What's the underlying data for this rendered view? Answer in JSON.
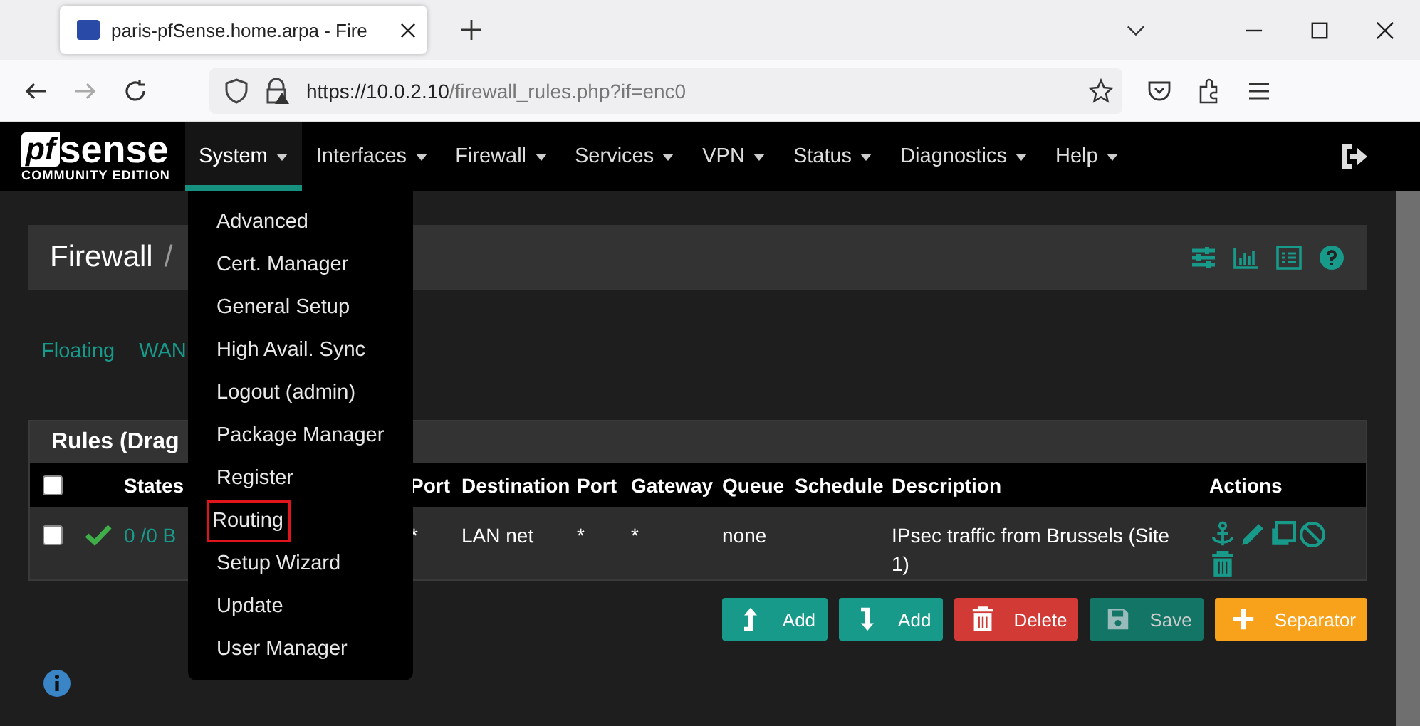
{
  "browser": {
    "tab_title": "paris-pfSense.home.arpa - Fire",
    "url_host": "https://10.0.2.10",
    "url_path": "/firewall_rules.php?if=enc0"
  },
  "logo": {
    "pf": "pf",
    "sense": "sense",
    "edition": "COMMUNITY EDITION"
  },
  "nav": [
    {
      "label": "System",
      "selected": true
    },
    {
      "label": "Interfaces",
      "selected": false
    },
    {
      "label": "Firewall",
      "selected": false
    },
    {
      "label": "Services",
      "selected": false
    },
    {
      "label": "VPN",
      "selected": false
    },
    {
      "label": "Status",
      "selected": false
    },
    {
      "label": "Diagnostics",
      "selected": false
    },
    {
      "label": "Help",
      "selected": false
    }
  ],
  "system_menu": [
    {
      "label": "Advanced",
      "highlighted": false
    },
    {
      "label": "Cert. Manager",
      "highlighted": false
    },
    {
      "label": "General Setup",
      "highlighted": false
    },
    {
      "label": "High Avail. Sync",
      "highlighted": false
    },
    {
      "label": "Logout (admin)",
      "highlighted": false
    },
    {
      "label": "Package Manager",
      "highlighted": false
    },
    {
      "label": "Register",
      "highlighted": false
    },
    {
      "label": "Routing",
      "highlighted": true
    },
    {
      "label": "Setup Wizard",
      "highlighted": false
    },
    {
      "label": "Update",
      "highlighted": false
    },
    {
      "label": "User Manager",
      "highlighted": false
    }
  ],
  "page_title": {
    "section": "Firewall",
    "separator": "/"
  },
  "tabs": [
    {
      "label": "Floating",
      "selected": false
    },
    {
      "label": "WAN",
      "selected": false
    }
  ],
  "rules_panel": {
    "title": "Rules (Drag",
    "header": {
      "select_all_checked": false,
      "states": "States",
      "port": "Port",
      "destination": "Destination",
      "port_2": "Port",
      "gateway": "Gateway",
      "queue": "Queue",
      "schedule": "Schedule",
      "description": "Description",
      "actions": "Actions"
    },
    "rows": [
      {
        "checked": false,
        "enabled": true,
        "states": "0 /0 B",
        "port": "*",
        "destination": "LAN net",
        "port_2": "*",
        "gateway": "*",
        "queue": "none",
        "description": "IPsec traffic from Brussels (Site 1)"
      }
    ]
  },
  "buttons": [
    {
      "kind": "add_top",
      "label": "Add",
      "disabled": false
    },
    {
      "kind": "add_bottom",
      "label": "Add",
      "disabled": false
    },
    {
      "kind": "delete",
      "label": "Delete",
      "disabled": false
    },
    {
      "kind": "save",
      "label": "Save",
      "disabled": true
    },
    {
      "kind": "separator",
      "label": "Separator",
      "disabled": false
    }
  ]
}
